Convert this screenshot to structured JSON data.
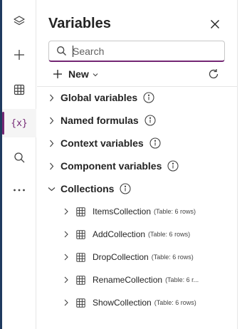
{
  "rail": {
    "items": [
      {
        "name": "tree-view",
        "icon": "layers-icon"
      },
      {
        "name": "insert",
        "icon": "plus-icon"
      },
      {
        "name": "data",
        "icon": "table-icon"
      },
      {
        "name": "variables",
        "icon": "variables-icon",
        "text": "{x}",
        "active": true
      },
      {
        "name": "search",
        "icon": "search-icon"
      },
      {
        "name": "more",
        "icon": "more-icon"
      }
    ]
  },
  "panel": {
    "title": "Variables",
    "search": {
      "placeholder": "Search",
      "value": ""
    },
    "new_label": "New",
    "groups": [
      {
        "label": "Global variables",
        "expanded": false
      },
      {
        "label": "Named formulas",
        "expanded": false
      },
      {
        "label": "Context variables",
        "expanded": false
      },
      {
        "label": "Component variables",
        "expanded": false
      },
      {
        "label": "Collections",
        "expanded": true
      }
    ],
    "collections": [
      {
        "name": "ItemsCollection",
        "meta": "(Table: 6 rows)"
      },
      {
        "name": "AddCollection",
        "meta": "(Table: 6 rows)"
      },
      {
        "name": "DropCollection",
        "meta": "(Table: 6 rows)"
      },
      {
        "name": "RenameCollection",
        "meta": "(Table: 6 r..."
      },
      {
        "name": "ShowCollection",
        "meta": "(Table: 6 rows)"
      }
    ]
  },
  "colors": {
    "accent": "#742774",
    "text": "#242424",
    "border": "#e6e6e6"
  }
}
